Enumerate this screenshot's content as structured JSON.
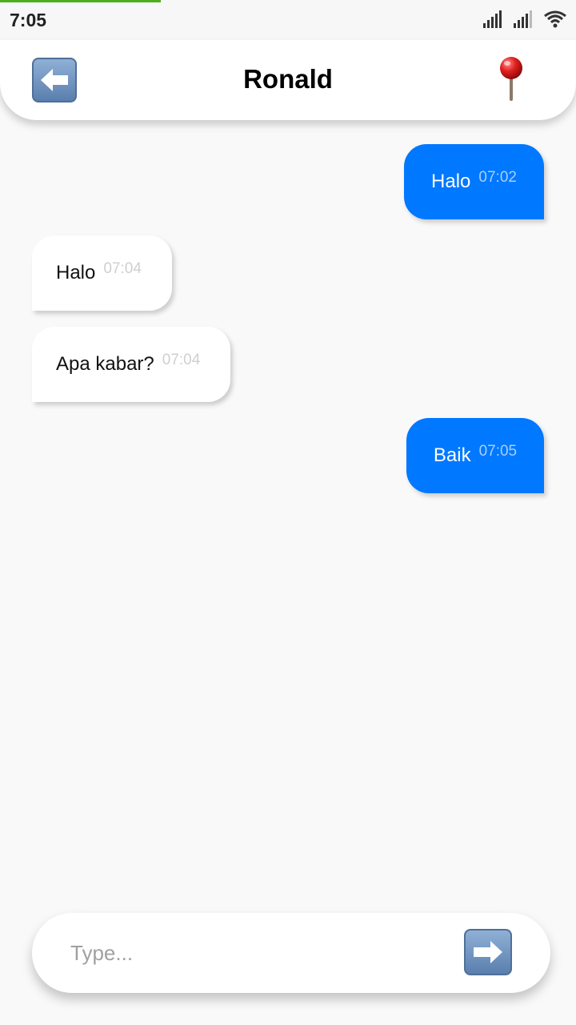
{
  "status_bar": {
    "time": "7:05",
    "icons": [
      "signal-icon",
      "signal-icon",
      "wifi-icon"
    ]
  },
  "header": {
    "title": "Ronald",
    "back_icon": "back-arrow-icon",
    "location_icon": "location-pin-icon"
  },
  "messages": [
    {
      "direction": "out",
      "text": "Halo",
      "time": "07:02"
    },
    {
      "direction": "in",
      "text": "Halo",
      "time": "07:04"
    },
    {
      "direction": "in",
      "text": "Apa kabar?",
      "time": "07:04"
    },
    {
      "direction": "out",
      "text": "Baik",
      "time": "07:05"
    }
  ],
  "composer": {
    "placeholder": "Type...",
    "value": "",
    "send_icon": "send-arrow-icon"
  },
  "colors": {
    "outgoing_bubble": "#0078ff",
    "incoming_bubble": "#ffffff",
    "background": "#f9f9f9",
    "progress": "#4caf1a"
  }
}
